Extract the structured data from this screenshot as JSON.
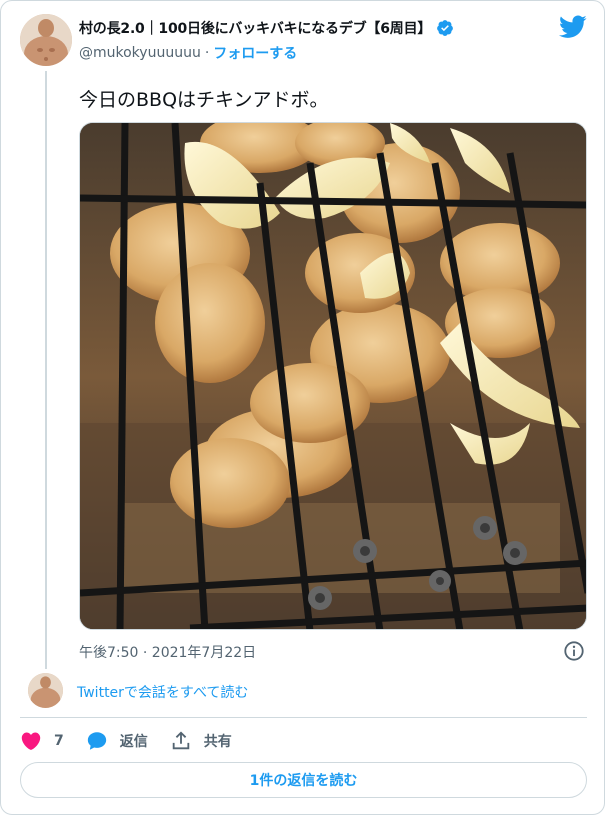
{
  "author": {
    "display_name": "村の長2.0｜100日後にバッキバキになるデブ【6周目】",
    "handle": "@mukokyuuuuuu",
    "separator": "·",
    "follow_label": "フォローする",
    "verified": true
  },
  "tweet": {
    "text": "今日のBBQはチキンアドボ。",
    "timestamp": "午後7:50 · 2021年7月22日"
  },
  "thread": {
    "read_conversation_label": "Twitterで会話をすべて読む"
  },
  "actions": {
    "like_count": "7",
    "reply_label": "返信",
    "share_label": "共有"
  },
  "footer": {
    "read_replies_label": "1件の返信を読む"
  },
  "colors": {
    "accent": "#1d9bf0",
    "like": "#f91880",
    "muted": "#536471",
    "border": "#cfd9de"
  },
  "icons": [
    "verified-badge-icon",
    "twitter-bird-icon",
    "info-icon",
    "heart-icon",
    "reply-bubble-icon",
    "share-icon"
  ]
}
